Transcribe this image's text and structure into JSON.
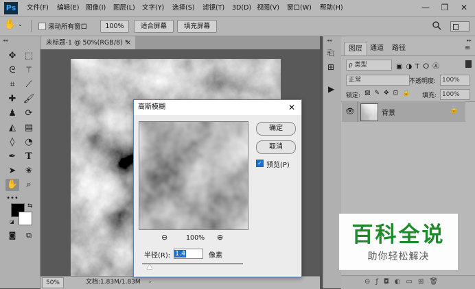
{
  "menubar": {
    "logo": "Ps",
    "items": [
      "文件(F)",
      "编辑(E)",
      "图像(I)",
      "图层(L)",
      "文字(Y)",
      "选择(S)",
      "滤镜(T)",
      "3D(D)",
      "视图(V)",
      "窗口(W)",
      "帮助(H)"
    ],
    "minimize": "—",
    "restore": "❐",
    "close": "✕"
  },
  "options": {
    "scroll_all_label": "滚动所有窗口",
    "zoom_value": "100%",
    "fit_screen": "适合屏幕",
    "fill_screen": "填充屏幕"
  },
  "document": {
    "tab_title": "未标题-1 @ 50%(RGB/8) *",
    "tab_close": "×",
    "status_zoom": "50%",
    "status_doc": "文档:1.83M/1.83M"
  },
  "layers_panel": {
    "tabs": [
      "图层",
      "通道",
      "路径"
    ],
    "filter_kind": "ρ 类型",
    "blend_mode": "正常",
    "opacity_label": "不透明度:",
    "opacity_value": "100%",
    "lock_label": "锁定:",
    "fill_label": "填充:",
    "fill_value": "100%",
    "layer_name": "背景"
  },
  "dialog": {
    "title": "高斯模糊",
    "ok": "确定",
    "cancel": "取消",
    "preview_label": "预览(P)",
    "preview_checked": true,
    "zoom_value": "100%",
    "radius_label": "半径(R):",
    "radius_value": "1.4",
    "unit": "像素",
    "close": "✕"
  },
  "watermark": {
    "title": "百科全说",
    "subtitle": "助你轻松解决"
  },
  "colors": {
    "accent": "#1b6fd1",
    "watermark_green": "#1f8a2c"
  }
}
